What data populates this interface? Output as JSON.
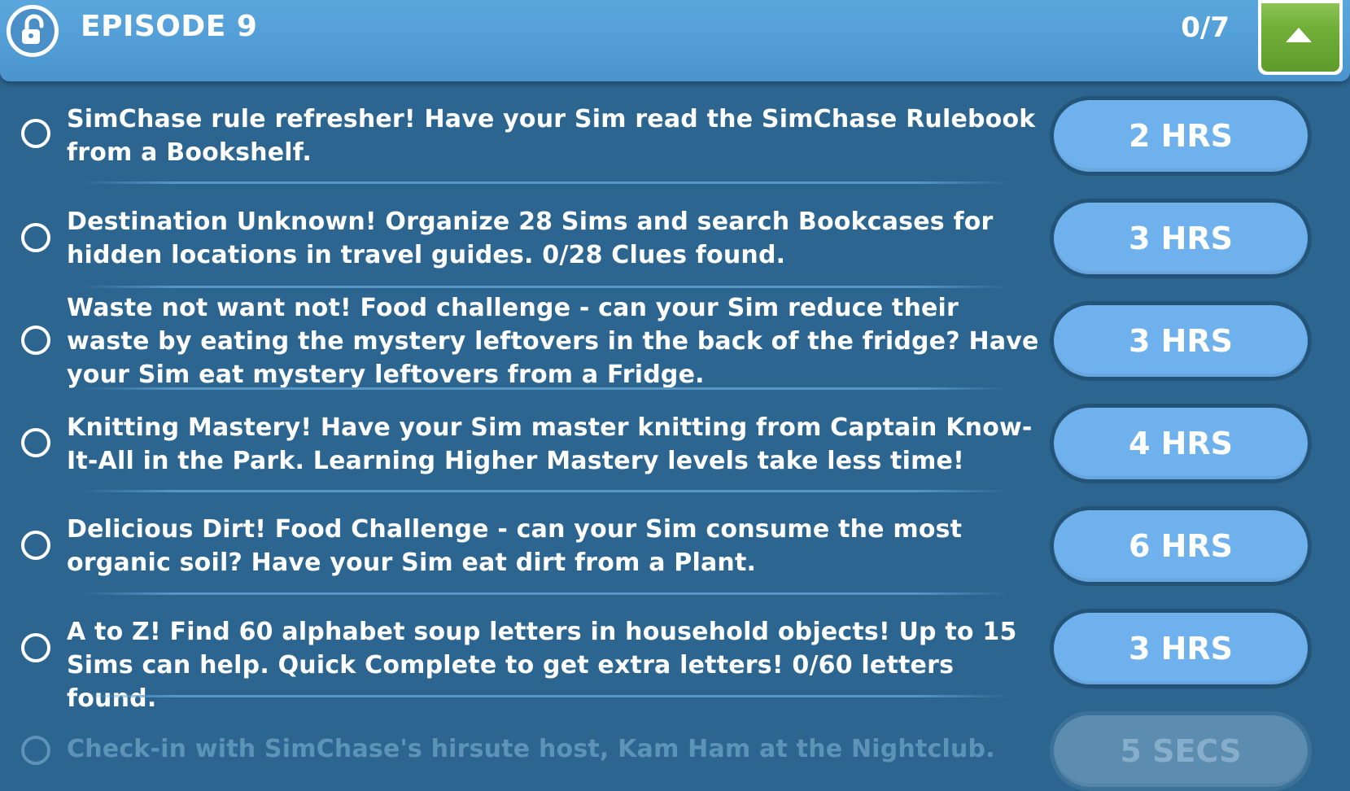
{
  "header": {
    "title": "EPISODE 9",
    "progress": "0/7",
    "icon": "unlock-icon",
    "collapse_icon": "caret-up-icon"
  },
  "tasks": [
    {
      "text": "SimChase rule refresher! Have your Sim read the SimChase Rulebook from a Bookshelf.",
      "time": "2 HRS",
      "enabled": true
    },
    {
      "text": "Destination Unknown! Organize 28 Sims and search Bookcases for hidden locations in travel guides. 0/28 Clues found.",
      "time": "3 HRS",
      "enabled": true
    },
    {
      "text": "Waste not want not! Food challenge - can your Sim reduce their waste by eating the mystery leftovers in the back of the fridge? Have your Sim eat mystery leftovers from a Fridge.",
      "time": "3 HRS",
      "enabled": true
    },
    {
      "text": "Knitting Mastery! Have your Sim master knitting from Captain Know-It-All in the Park. Learning Higher Mastery levels take less time!",
      "time": "4 HRS",
      "enabled": true
    },
    {
      "text": "Delicious Dirt! Food Challenge - can your Sim consume the most organic soil? Have your Sim eat dirt from a Plant.",
      "time": "6 HRS",
      "enabled": true
    },
    {
      "text": "A to Z! Find 60 alphabet soup letters in household objects! Up to 15 Sims can help. Quick Complete to get extra letters! 0/60 letters found.",
      "time": "3 HRS",
      "enabled": true
    },
    {
      "text": "Check-in with SimChase's hirsute host, Kam Ham at the Nightclub.",
      "time": "5 SECS",
      "enabled": false
    }
  ],
  "colors": {
    "background": "#2c6690",
    "header": "#4b94cf",
    "time_button": "#6eb1ec",
    "collapse_button": "#72af3a"
  }
}
